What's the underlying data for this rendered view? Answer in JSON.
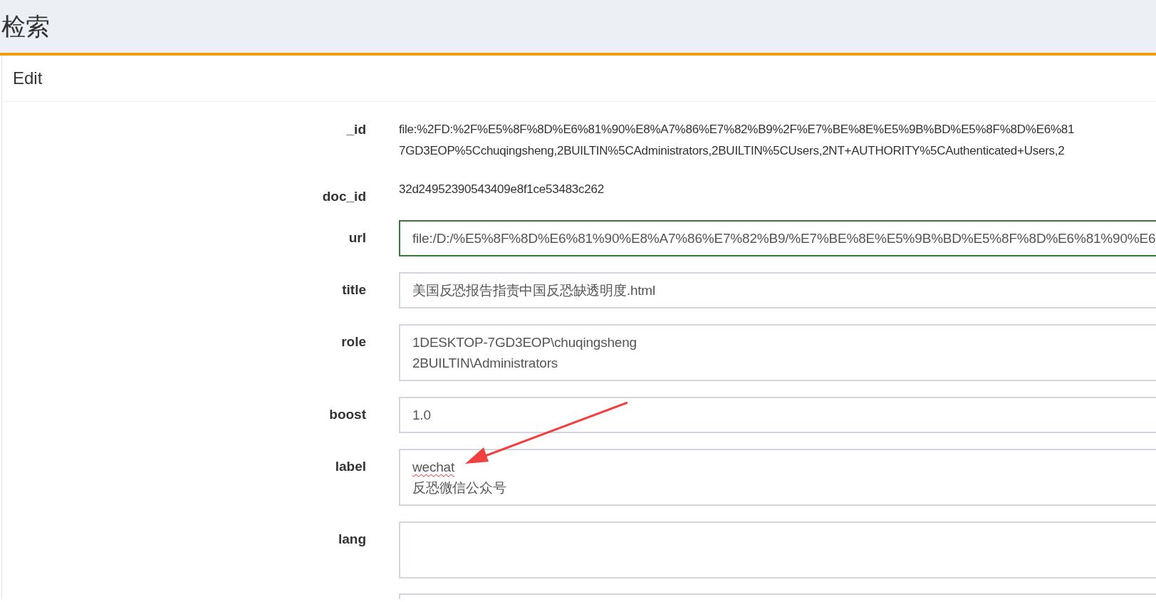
{
  "page": {
    "title": "检索"
  },
  "panel": {
    "title": "Edit"
  },
  "fields": [
    {
      "label": "_id",
      "kind": "static",
      "lines": [
        "file:%2FD:%2F%E5%8F%8D%E6%81%90%E8%A7%86%E7%82%B9%2F%E7%BE%8E%E5%9B%BD%E5%8F%8D%E6%81",
        "7GD3EOP%5Cchuqingsheng,2BUILTIN%5CAdministrators,2BUILTIN%5CUsers,2NT+AUTHORITY%5CAuthenticated+Users,2"
      ]
    },
    {
      "label": "doc_id",
      "kind": "static",
      "lines": [
        "32d24952390543409e8f1ce53483c262"
      ]
    },
    {
      "label": "url",
      "kind": "input",
      "focused": true,
      "lines": [
        "file:/D:/%E5%8F%8D%E6%81%90%E8%A7%86%E7%82%B9/%E7%BE%8E%E5%9B%BD%E5%8F%8D%E6%81%90%E6"
      ]
    },
    {
      "label": "title",
      "kind": "input",
      "focused": false,
      "lines": [
        "美国反恐报告指责中国反恐缺透明度.html"
      ]
    },
    {
      "label": "role",
      "kind": "textarea",
      "focused": false,
      "lines": [
        "1DESKTOP-7GD3EOP\\chuqingsheng",
        "2BUILTIN\\Administrators"
      ]
    },
    {
      "label": "boost",
      "kind": "input",
      "focused": false,
      "lines": [
        "1.0"
      ]
    },
    {
      "label": "label",
      "kind": "textarea",
      "focused": false,
      "lines": [
        "wechat",
        "反恐微信公众号"
      ]
    },
    {
      "label": "lang",
      "kind": "textarea",
      "focused": false
    }
  ]
}
